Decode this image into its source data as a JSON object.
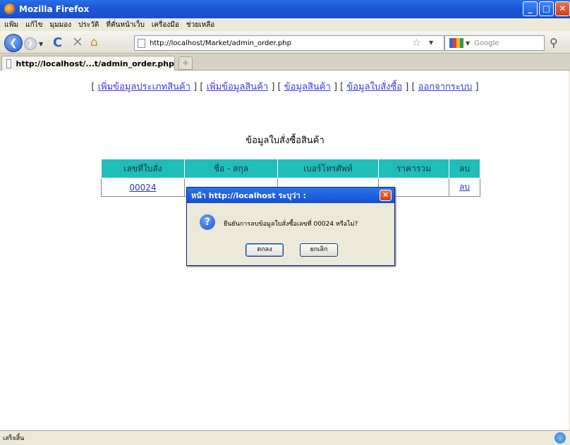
{
  "window": {
    "title": "Mozilla Firefox"
  },
  "menu": [
    "แฟ้ม",
    "แก้ไข",
    "มุมมอง",
    "ประวัติ",
    "ที่คั่นหน้าเว็บ",
    "เครื่องมือ",
    "ช่วยเหลือ"
  ],
  "toolbar": {
    "url": "http://localhost/Market/admin_order.php",
    "search_placeholder": "Google"
  },
  "tab": {
    "title": "http://localhost/...t/admin_order.php",
    "new_tab": "+"
  },
  "page": {
    "nav": [
      {
        "label": "เพิ่มข้อมูลประเภทสินค้า"
      },
      {
        "label": "เพิ่มข้อมูลสินค้า"
      },
      {
        "label": "ข้อมูลสินค้า"
      },
      {
        "label": "ข้อมูลใบสั่งซื้อ"
      },
      {
        "label": "ออกจากระบบ"
      }
    ],
    "heading": "ข้อมูลใบสั่งซื้อสินค้า",
    "table": {
      "headers": [
        "เลขที่ใบสั่ง",
        "ชื่อ - สกุล",
        "เบอร์โทรศัพท์",
        "ราคารวม",
        "ลบ"
      ],
      "rows": [
        [
          "00024",
          "",
          "",
          "",
          "ลบ"
        ]
      ]
    }
  },
  "dialog": {
    "title": "หน้า http://localhost ระบุว่า :",
    "message": "ยืนยันการลบข้อมูลใบสั่งซื้อเลขที่ 00024 หรือไม่?",
    "ok": "ตกลง",
    "cancel": "ยกเลิก"
  },
  "status": {
    "text": "เสร็จสิ้น"
  }
}
